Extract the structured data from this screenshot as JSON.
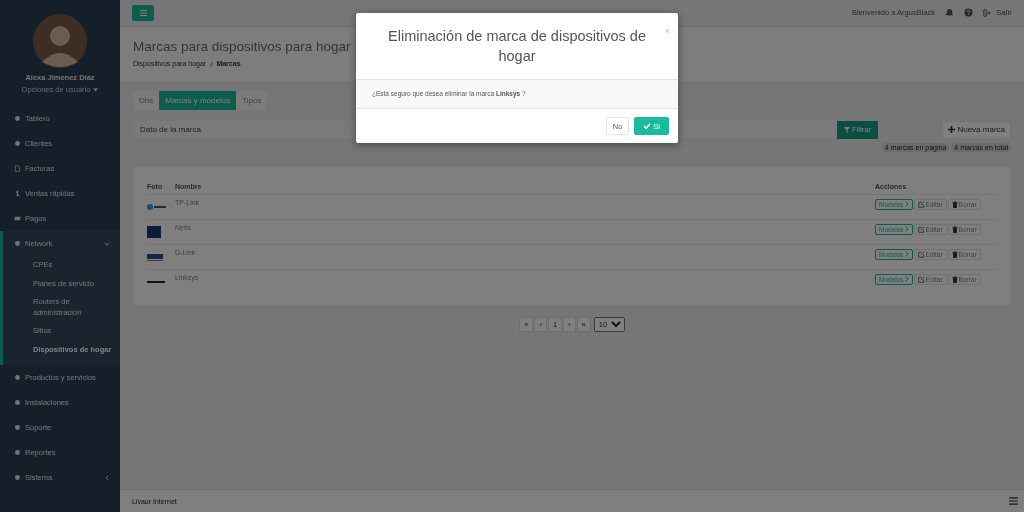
{
  "sidebar": {
    "user": {
      "name": "Alexa Jimenez Díaz",
      "options_label": "Opciones de usuario"
    },
    "items": [
      {
        "label": "Tablero",
        "kind": "link"
      },
      {
        "label": "Clientes",
        "kind": "link"
      },
      {
        "label": "Facturas",
        "kind": "link"
      },
      {
        "label": "Ventas rápidas",
        "kind": "link"
      },
      {
        "label": "Pagos",
        "kind": "link"
      },
      {
        "label": "Network",
        "kind": "group",
        "expanded": true,
        "children": [
          {
            "label": "CPEs",
            "selected": false
          },
          {
            "label": "Planes de servicio",
            "selected": false
          },
          {
            "label": "Routers de administración",
            "selected": false
          },
          {
            "label": "Sitios",
            "selected": false
          },
          {
            "label": "Dispositivos de hogar",
            "selected": true
          }
        ]
      },
      {
        "label": "Productos y servicios",
        "kind": "link"
      },
      {
        "label": "Instalaciones",
        "kind": "link"
      },
      {
        "label": "Soporte",
        "kind": "link"
      },
      {
        "label": "Reportes",
        "kind": "link"
      },
      {
        "label": "Sistema",
        "kind": "group",
        "expanded": false
      }
    ]
  },
  "top_bar": {
    "welcome": "Bienvenido a ArgusBlack",
    "logout": "Salir"
  },
  "page": {
    "title": "Marcas para dispositivos para hogar",
    "breadcrumb_separator": "/",
    "breadcrumb": [
      {
        "label": "Dispositivos para hogar",
        "current": false
      },
      {
        "label": "Marcas",
        "current": true
      }
    ]
  },
  "tabs": [
    {
      "label": "Dhs",
      "selected": false
    },
    {
      "label": "Marcas y modelos",
      "selected": true
    },
    {
      "label": "Tipos",
      "selected": false
    }
  ],
  "search": {
    "placeholder": "Dato de la marca",
    "filter_button": "Filtrar"
  },
  "new_button": "Nueva marca",
  "badges": [
    "4 marcas en página",
    "4 marcas en total"
  ],
  "table": {
    "columns": [
      "Foto",
      "Nombre",
      "Acciones"
    ],
    "rows": [
      {
        "name": "TP-Link",
        "actions": [
          "Modelos",
          "Editar",
          "Borrar"
        ]
      },
      {
        "name": "Netis",
        "actions": [
          "Modelos",
          "Editar",
          "Borrar"
        ]
      },
      {
        "name": "D-Link",
        "actions": [
          "Modelos",
          "Editar",
          "Borrar"
        ]
      },
      {
        "name": "Linksys",
        "actions": [
          "Modelos",
          "Editar",
          "Borrar"
        ]
      }
    ]
  },
  "pagination": {
    "buttons": [
      "«",
      "‹",
      "1",
      "›",
      "»"
    ],
    "page_size": "10"
  },
  "footer": {
    "text": "Livaur Internet"
  },
  "modal": {
    "title": "Eliminación de marca de dispositivos de hogar",
    "close": "×",
    "message": "¿Está seguro que desea eliminar la marca **Linksys** ?",
    "buttons": [
      {
        "label": "No",
        "kind": "cancel"
      },
      {
        "label": "Si",
        "kind": "confirm"
      }
    ]
  }
}
